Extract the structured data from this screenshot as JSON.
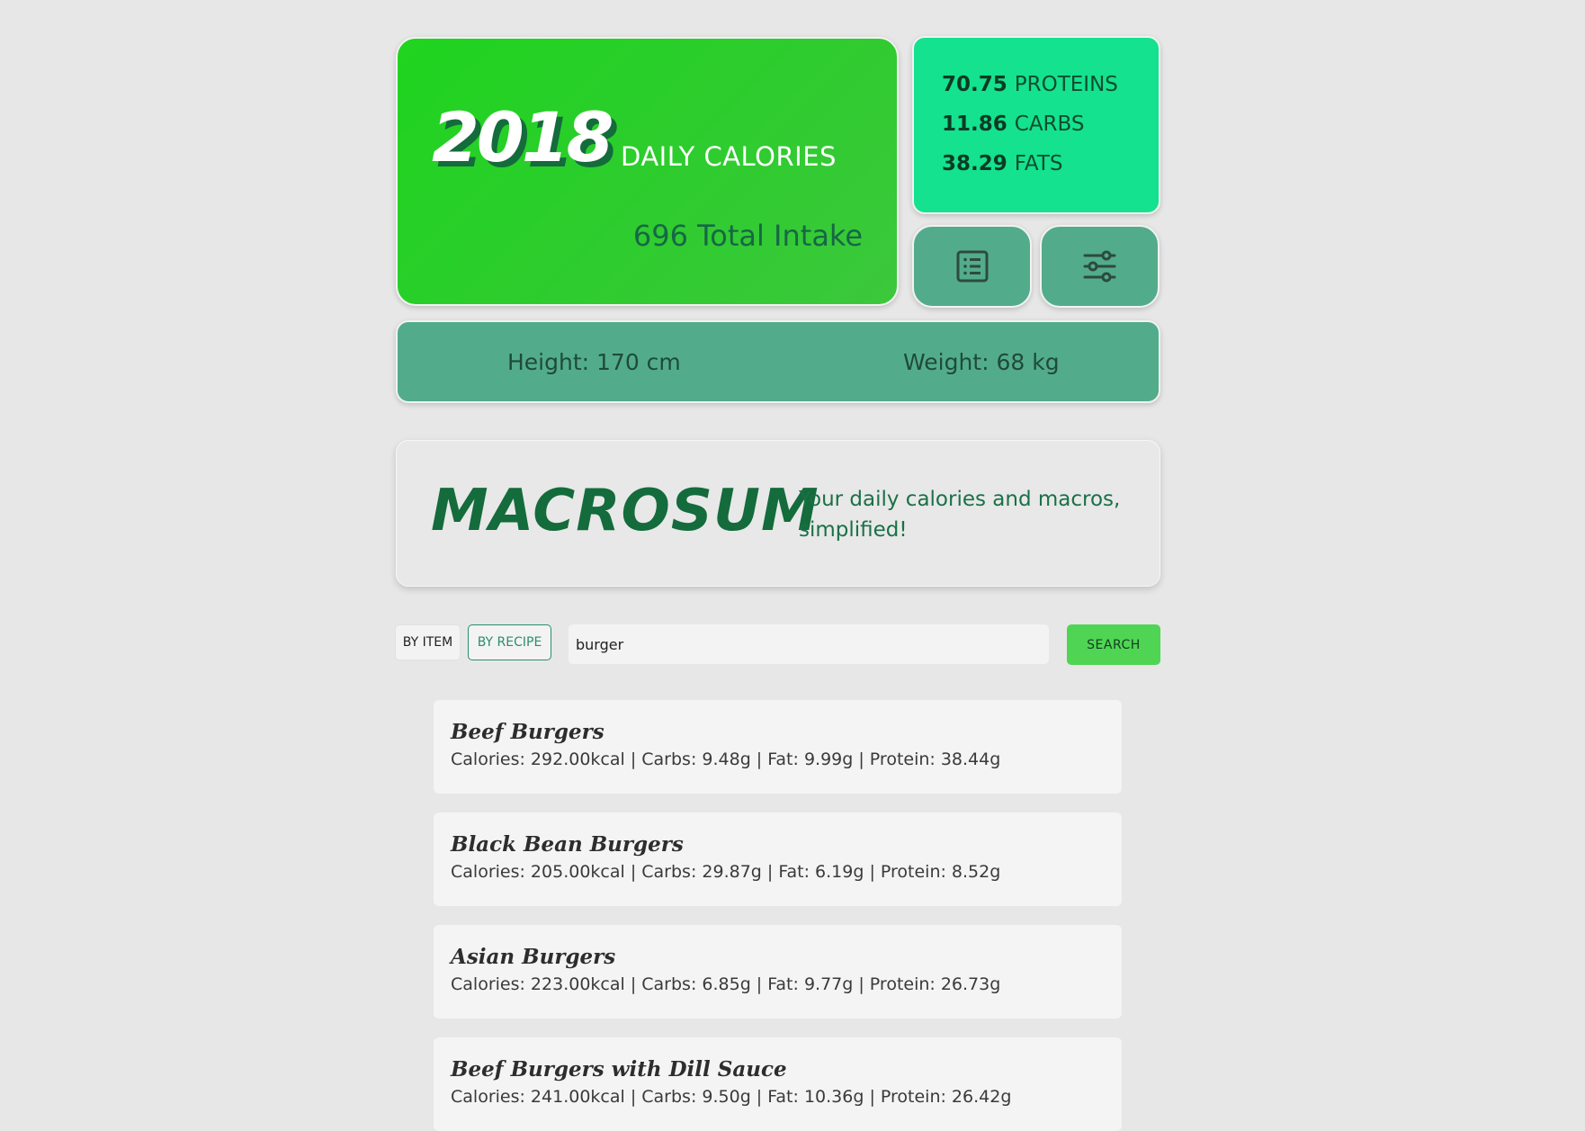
{
  "summary": {
    "daily_calories": "2018",
    "daily_calories_label": "DAILY CALORIES",
    "total_intake": "696 Total Intake"
  },
  "macros": {
    "proteins_value": "70.75",
    "proteins_label": "PROTEINS",
    "carbs_value": "11.86",
    "carbs_label": "CARBS",
    "fats_value": "38.29",
    "fats_label": "FATS"
  },
  "buttons": {
    "list_icon": "list-icon",
    "settings_icon": "sliders-icon"
  },
  "body_stats": {
    "height": "Height: 170 cm",
    "weight": "Weight: 68 kg"
  },
  "brand": {
    "name": "MACROSUM",
    "tagline": "Your daily calories and macros, simplified!"
  },
  "search": {
    "mode_item": "BY ITEM",
    "mode_recipe": "BY RECIPE",
    "query": "burger",
    "button": "SEARCH"
  },
  "results": [
    {
      "title": "Beef Burgers",
      "info": "Calories: 292.00kcal | Carbs: 9.48g | Fat: 9.99g | Protein: 38.44g"
    },
    {
      "title": "Black Bean Burgers",
      "info": "Calories: 205.00kcal | Carbs: 29.87g | Fat: 6.19g | Protein: 8.52g"
    },
    {
      "title": "Asian Burgers",
      "info": "Calories: 223.00kcal | Carbs: 6.85g | Fat: 9.77g | Protein: 26.73g"
    },
    {
      "title": "Beef Burgers with Dill Sauce",
      "info": "Calories: 241.00kcal | Carbs: 9.50g | Fat: 10.36g | Protein: 26.42g"
    }
  ],
  "colors": {
    "calorie_card": "#2ecc2e",
    "macro_card": "#14e28e",
    "teal": "#52ac8c",
    "brand_green": "#146b3c",
    "search_button": "#4fd553"
  }
}
